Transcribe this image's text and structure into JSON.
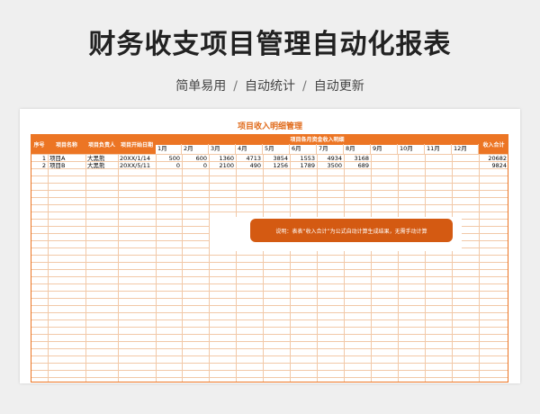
{
  "page": {
    "title": "财务收支项目管理自动化报表",
    "subtitle_items": [
      "简单易用",
      "自动统计",
      "自动更新"
    ],
    "separator": "/"
  },
  "sheet": {
    "title": "项目收入明细管理",
    "headers": {
      "seq": "序号",
      "name": "项目名称",
      "owner": "项目负责人",
      "start": "项目开始日期",
      "monthly_group": "项目各月资金收入明细",
      "total": "收入合计"
    },
    "months": [
      "1月",
      "2月",
      "3月",
      "4月",
      "5月",
      "6月",
      "7月",
      "8月",
      "9月",
      "10月",
      "11月",
      "12月"
    ],
    "rows": [
      {
        "seq": "1",
        "name": "项目A",
        "owner": "大黑熊",
        "start": "20XX/1/14",
        "values": [
          "500",
          "600",
          "1360",
          "4713",
          "3854",
          "1553",
          "4934",
          "3168",
          "",
          "",
          "",
          ""
        ],
        "total": "20682"
      },
      {
        "seq": "2",
        "name": "项目B",
        "owner": "大黑熊",
        "start": "20XX/5/11",
        "values": [
          "0",
          "0",
          "2100",
          "490",
          "1256",
          "1789",
          "3500",
          "689",
          "",
          "",
          "",
          ""
        ],
        "total": "9824"
      }
    ],
    "note": "说明：表表“收入合计”为公式自动计算生成结果，无需手动计算"
  },
  "colors": {
    "accent": "#ec7524",
    "note_bg": "#d45a12",
    "grid_line": "#f2c9a8"
  }
}
